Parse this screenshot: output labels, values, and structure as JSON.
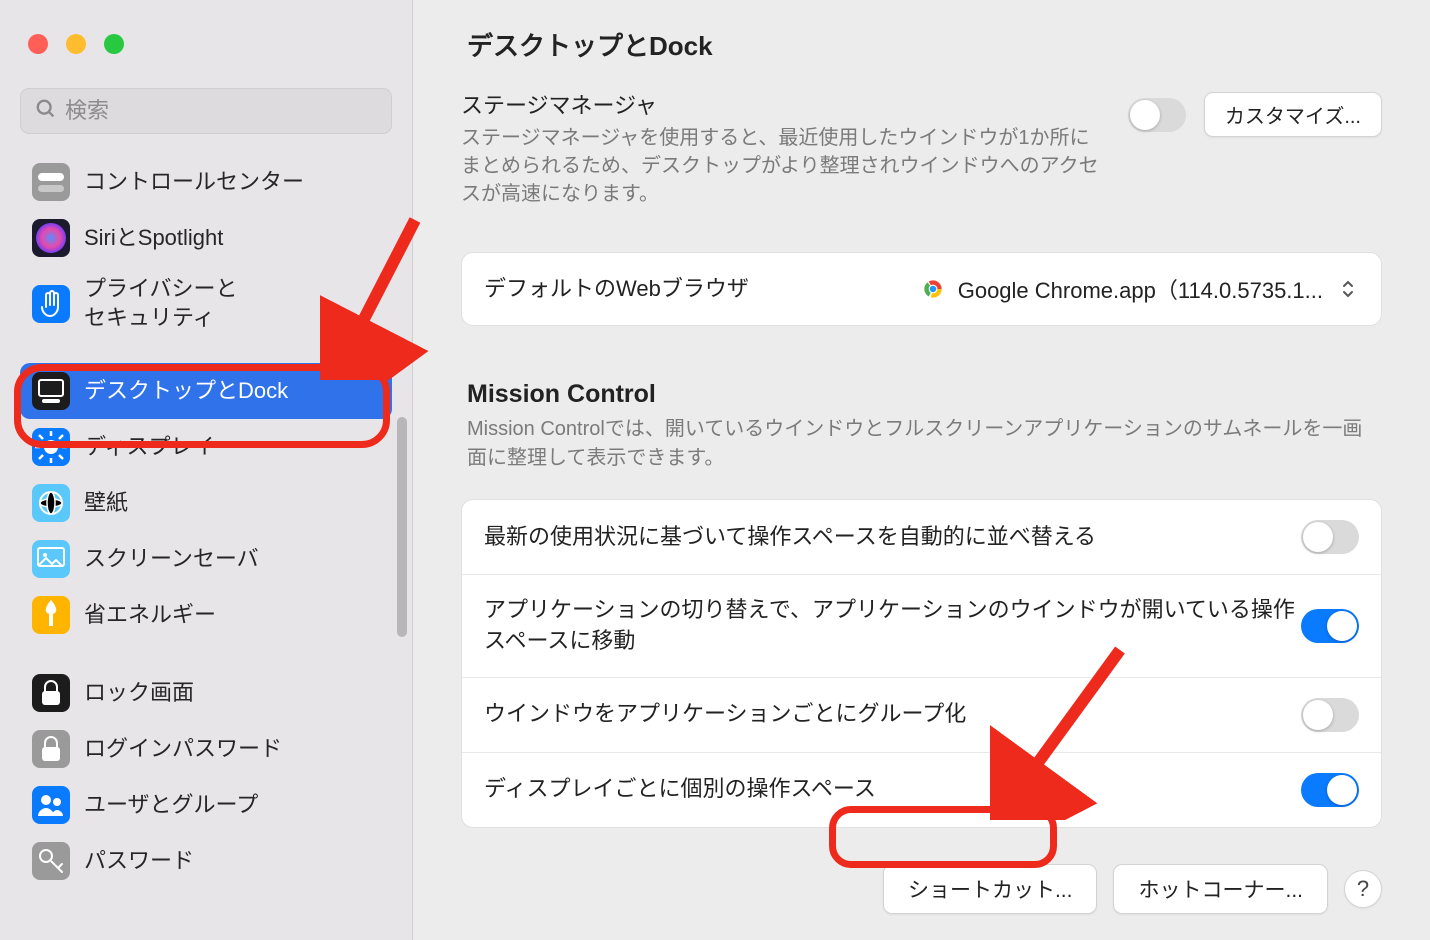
{
  "header": {
    "title": "デスクトップとDock"
  },
  "search": {
    "placeholder": "検索"
  },
  "sidebar": {
    "items": [
      {
        "label": "コントロールセンター",
        "icon": "control-center",
        "bg": "#9a9a9a"
      },
      {
        "label": "SiriとSpotlight",
        "icon": "siri",
        "bg": "#1b1b2d"
      },
      {
        "label": "プライバシーと\nセキュリティ",
        "icon": "hand",
        "bg": "#0a7aff"
      },
      {
        "label": "デスクトップとDock",
        "icon": "desktop-dock",
        "bg": "#1c1c1c",
        "selected": true
      },
      {
        "label": "ディスプレイ",
        "icon": "display",
        "bg": "#0a7aff"
      },
      {
        "label": "壁紙",
        "icon": "wallpaper",
        "bg": "#5ac8fa"
      },
      {
        "label": "スクリーンセーバ",
        "icon": "screensaver",
        "bg": "#5ac8fa"
      },
      {
        "label": "省エネルギー",
        "icon": "energy",
        "bg": "#ffb400"
      },
      {
        "label": "ロック画面",
        "icon": "lock",
        "bg": "#1c1c1c"
      },
      {
        "label": "ログインパスワード",
        "icon": "login-password",
        "bg": "#9a9a9a"
      },
      {
        "label": "ユーザとグループ",
        "icon": "users",
        "bg": "#0a7aff"
      },
      {
        "label": "パスワード",
        "icon": "key",
        "bg": "#9a9a9a"
      }
    ]
  },
  "stage": {
    "title": "ステージマネージャ",
    "desc": "ステージマネージャを使用すると、最近使用したウインドウが1か所にまとめられるため、デスクトップがより整理されウインドウへのアクセスが高速になります。",
    "toggle": false,
    "customize_label": "カスタマイズ..."
  },
  "browser": {
    "label": "デフォルトのWebブラウザ",
    "value": "Google Chrome.app（114.0.5735.1..."
  },
  "mission_control": {
    "title": "Mission Control",
    "desc": "Mission Controlでは、開いているウインドウとフルスクリーンアプリケーションのサムネールを一画面に整理して表示できます。",
    "rows": [
      {
        "label": "最新の使用状況に基づいて操作スペースを自動的に並べ替える",
        "on": false
      },
      {
        "label": "アプリケーションの切り替えで、アプリケーションのウインドウが開いている操作スペースに移動",
        "on": true
      },
      {
        "label": "ウインドウをアプリケーションごとにグループ化",
        "on": false
      },
      {
        "label": "ディスプレイごとに個別の操作スペース",
        "on": true
      }
    ]
  },
  "buttons": {
    "shortcuts": "ショートカット...",
    "hotcorners": "ホットコーナー...",
    "help": "?"
  }
}
